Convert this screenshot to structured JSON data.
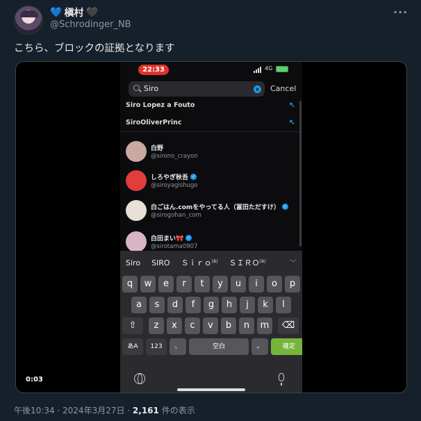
{
  "author": {
    "name": "槇村",
    "heart_left": "💙",
    "heart_right": "🖤",
    "handle": "@Schrodinger_NB"
  },
  "more_icon": "···",
  "tweet_text": "こちら、ブロックの証拠となります",
  "video": {
    "timestamp": "0:03",
    "phone": {
      "time": "22:33",
      "network": "4G",
      "search": {
        "value": "Siro",
        "cancel": "Cancel",
        "clear_icon": "x-circle-icon"
      },
      "suggestions": [
        {
          "text": "Siro Lopez a Fouto",
          "icon": "arrow-up-left-icon"
        },
        {
          "text": "SiroOliverPrinc",
          "icon": "arrow-up-left-icon"
        }
      ],
      "users": [
        {
          "name": "白野",
          "handle": "@sirono_crayon",
          "verified": false,
          "avatar_color": "#c9a9a2"
        },
        {
          "name": "しろやぎ秋吾",
          "handle": "@siroyagishugo",
          "verified": true,
          "avatar_color": "#e23c3c"
        },
        {
          "name": "白ごはん.comをやってる人（冨田ただすけ）",
          "handle": "@sirogohan_com",
          "verified": true,
          "avatar_color": "#e8e0d6"
        },
        {
          "name": "白田まい🎀",
          "handle": "@sirotama0907",
          "verified": true,
          "avatar_color": "#d8b4c4"
        }
      ],
      "keyboard": {
        "candidates": [
          "Siro",
          "SIRO",
          "Ｓｉｒｏ",
          "ＳＩＲＯ"
        ],
        "candidate_marks": [
          "",
          "",
          "[全]",
          "[全]"
        ],
        "row1": [
          "q",
          "w",
          "e",
          "r",
          "t",
          "y",
          "u",
          "i",
          "o",
          "p"
        ],
        "row2": [
          "a",
          "s",
          "d",
          "f",
          "g",
          "h",
          "j",
          "k",
          "l"
        ],
        "row3": [
          "⇧",
          "z",
          "x",
          "c",
          "v",
          "b",
          "n",
          "m",
          "⌫"
        ],
        "row4": [
          "あA",
          "123",
          "、",
          "空白",
          "。",
          "確定"
        ]
      }
    }
  },
  "footer": {
    "time": "午後10:34 · 2024年3月27日 · ",
    "views": "2,161",
    "views_suffix": " 件の表示"
  }
}
